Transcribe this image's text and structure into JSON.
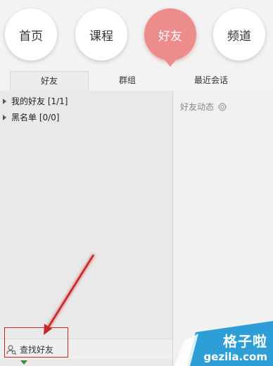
{
  "nav": {
    "items": [
      {
        "label": "首页"
      },
      {
        "label": "课程"
      },
      {
        "label": "好友"
      },
      {
        "label": "频道"
      }
    ],
    "active_color": "#ec8c8c"
  },
  "tabs": [
    {
      "label": "好友"
    },
    {
      "label": "群组"
    },
    {
      "label": "最近会话"
    }
  ],
  "friend_groups": [
    {
      "label": "我的好友 [1/1]"
    },
    {
      "label": "黑名单 [0/0]"
    }
  ],
  "footer": {
    "find_friend_label": "查找好友"
  },
  "feed": {
    "header_label": "好友动态"
  },
  "watermark": {
    "text_cn": "格子啦",
    "text_en": "gezila.com"
  },
  "annotation": {
    "color": "#c62828"
  }
}
